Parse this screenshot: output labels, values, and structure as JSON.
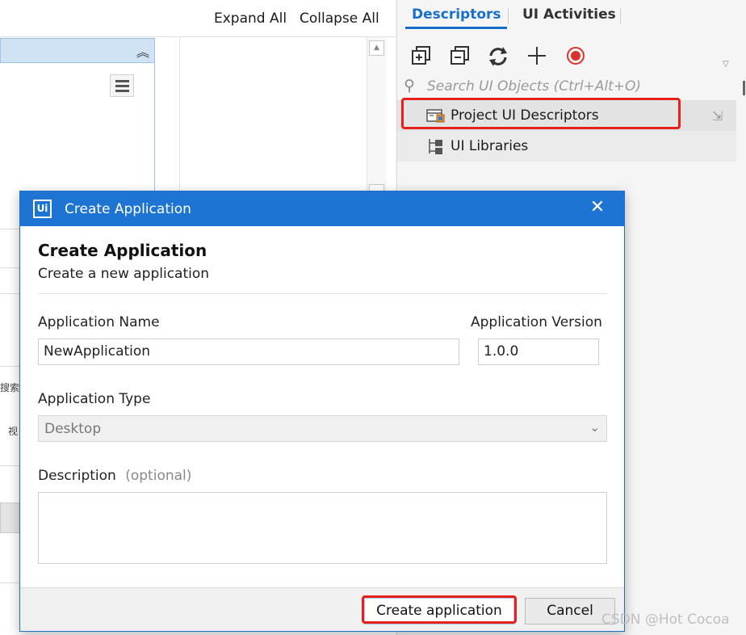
{
  "left": {
    "expand_all": "Expand All",
    "collapse_all": "Collapse All",
    "tiny_texts": [
      "搜索",
      "视"
    ]
  },
  "right_panel": {
    "tabs": [
      {
        "label": "Descriptors",
        "active": true
      },
      {
        "label": "UI Activities",
        "active": false
      }
    ],
    "toolbar_icons": [
      "expand-all-icon",
      "collapse-all-icon",
      "refresh-icon",
      "add-icon",
      "record-icon"
    ],
    "search": {
      "placeholder": "Search UI Objects (Ctrl+Alt+O)"
    },
    "tree": [
      {
        "label": "Project UI Descriptors",
        "icon": "project-descriptors-icon",
        "highlighted": true
      },
      {
        "label": "UI Libraries",
        "icon": "libraries-icon",
        "highlighted": false
      }
    ]
  },
  "dialog": {
    "window_title": "Create Application",
    "logo": "Ui",
    "heading": "Create Application",
    "subtitle": "Create a new application",
    "fields": {
      "name_label": "Application Name",
      "name_value": "NewApplication",
      "version_label": "Application Version",
      "version_value": "1.0.0",
      "type_label": "Application Type",
      "type_value": "Desktop",
      "description_label": "Description",
      "description_optional": "(optional)",
      "description_value": ""
    },
    "buttons": {
      "create": "Create application",
      "cancel": "Cancel"
    }
  },
  "watermark": "CSDN @Hot Cocoa",
  "colors": {
    "accent": "#1e74d2",
    "tab_active": "#1a6fc9",
    "highlight_red": "#e8201a",
    "record_red": "#d9342b"
  }
}
